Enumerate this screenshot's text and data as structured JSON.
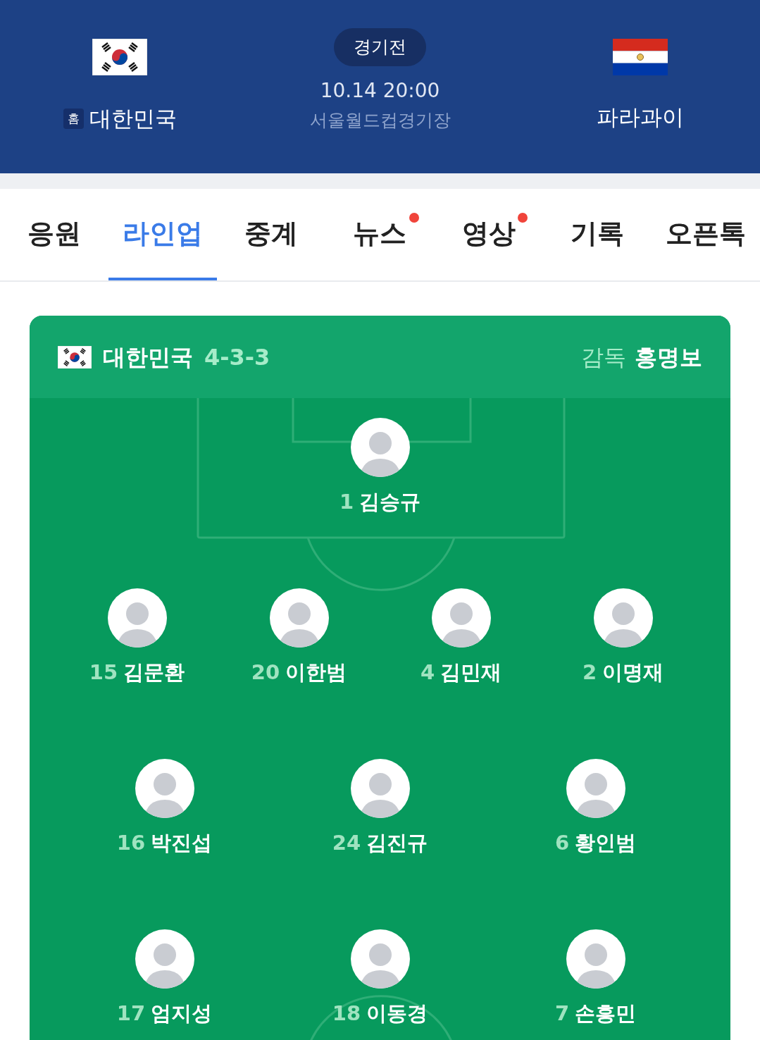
{
  "match": {
    "home": {
      "name": "대한민국",
      "badge": "홈"
    },
    "status": "경기전",
    "datetime": "10.14 20:00",
    "venue": "서울월드컵경기장",
    "away": {
      "name": "파라과이"
    }
  },
  "tabs": [
    {
      "label": "응원",
      "selected": false,
      "new_dot": false
    },
    {
      "label": "라인업",
      "selected": true,
      "new_dot": false
    },
    {
      "label": "중계",
      "selected": false,
      "new_dot": false
    },
    {
      "label": "뉴스",
      "selected": false,
      "new_dot": true
    },
    {
      "label": "영상",
      "selected": false,
      "new_dot": true
    },
    {
      "label": "기록",
      "selected": false,
      "new_dot": false
    },
    {
      "label": "오픈톡",
      "selected": false,
      "new_dot": false
    }
  ],
  "lineup": {
    "team": "대한민국",
    "formation": "4-3-3",
    "coach_label": "감독",
    "coach": "홍명보",
    "lines": [
      [
        {
          "number": "1",
          "name": "김승규"
        }
      ],
      [
        {
          "number": "15",
          "name": "김문환"
        },
        {
          "number": "20",
          "name": "이한범"
        },
        {
          "number": "4",
          "name": "김민재"
        },
        {
          "number": "2",
          "name": "이명재"
        }
      ],
      [
        {
          "number": "16",
          "name": "박진섭"
        },
        {
          "number": "24",
          "name": "김진규"
        },
        {
          "number": "6",
          "name": "황인범"
        }
      ],
      [
        {
          "number": "17",
          "name": "엄지성"
        },
        {
          "number": "18",
          "name": "이동경"
        },
        {
          "number": "7",
          "name": "손흥민"
        }
      ]
    ]
  }
}
